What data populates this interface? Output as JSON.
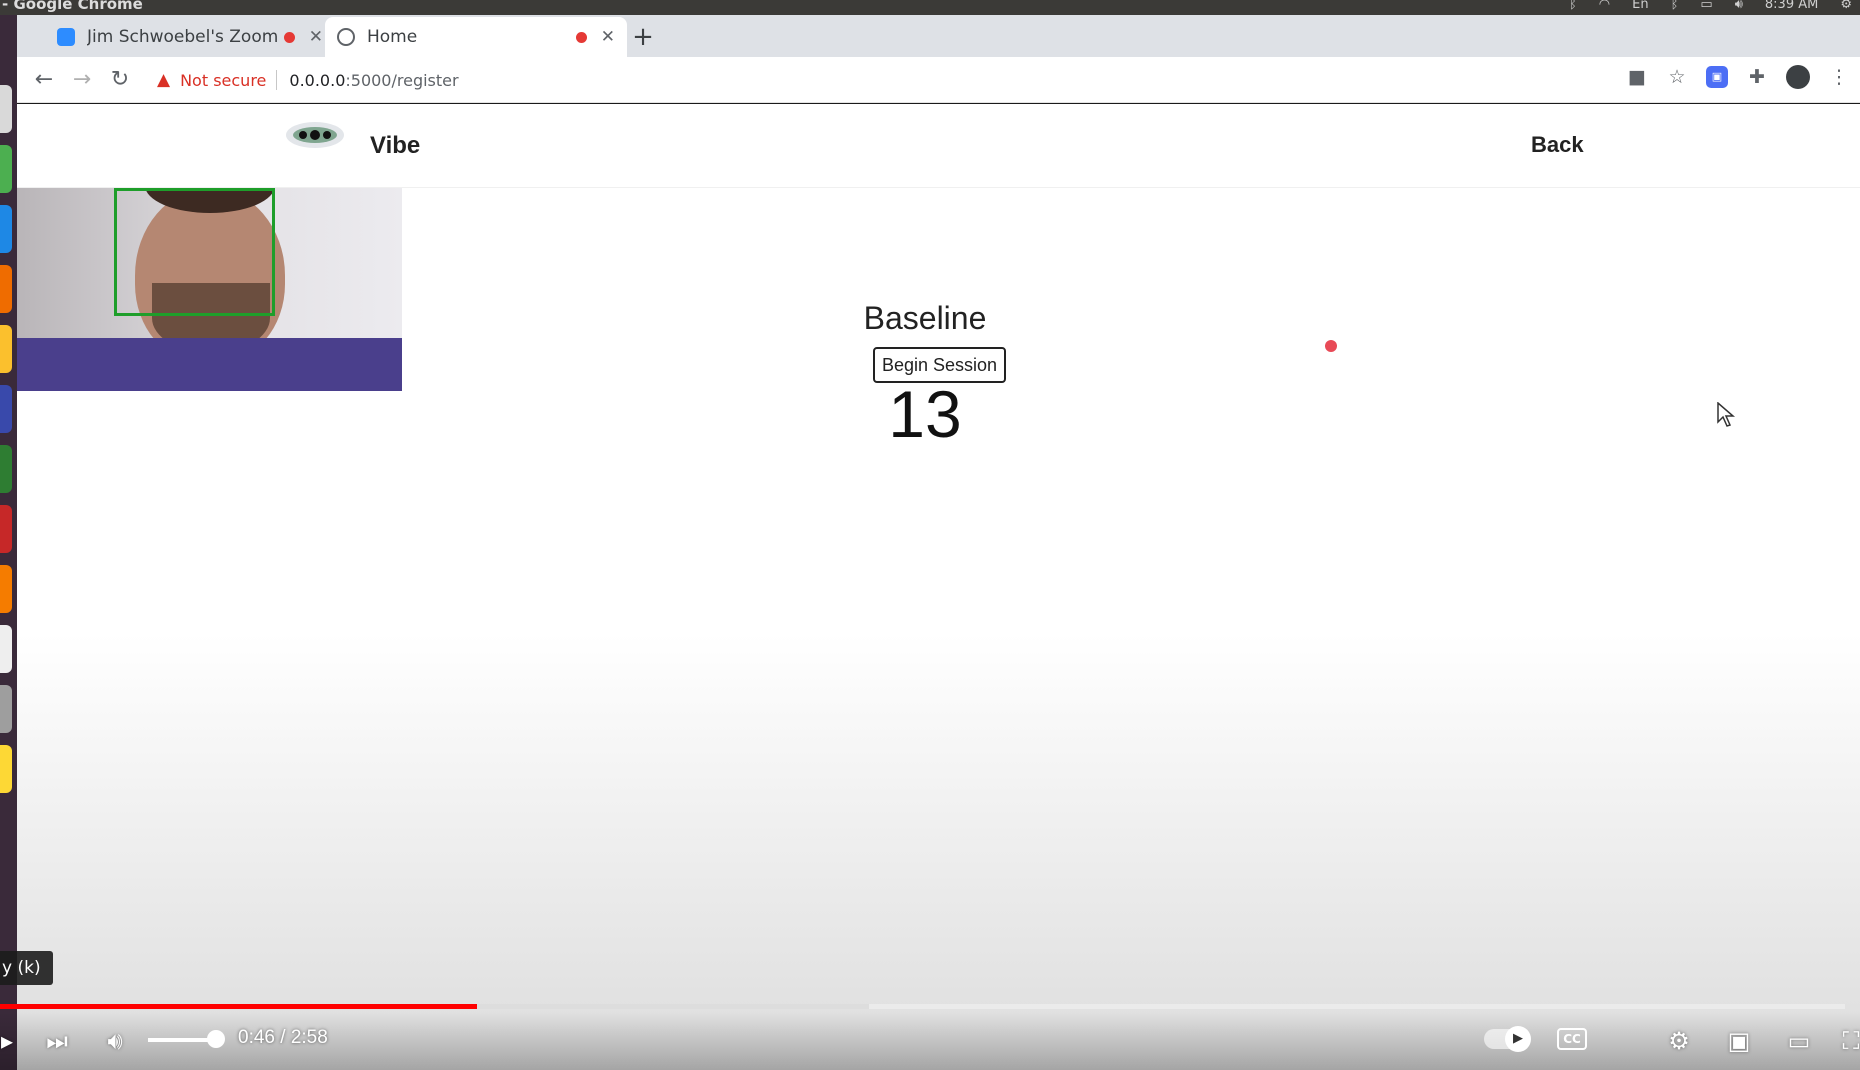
{
  "os": {
    "app_title": "- Google Chrome",
    "clock": "8:39 AM",
    "tray_lang": "En"
  },
  "tabs": [
    {
      "title": "Jim Schwoebel's Zoom",
      "recording": true
    },
    {
      "title": "Home",
      "recording": true
    }
  ],
  "toolbar": {
    "security_label": "Not secure",
    "url_host": "0.0.0.0",
    "url_path": ":5000/register"
  },
  "site": {
    "brand": "Vibe",
    "back_label": "Back"
  },
  "main": {
    "title": "Baseline",
    "begin_button": "Begin Session",
    "countdown": "13"
  },
  "player": {
    "tooltip": "y (k)",
    "time": "0:46 / 2:58",
    "played_fraction": 0.2584,
    "buffered_fraction": 0.4708,
    "cc_label": "CC"
  },
  "colors": {
    "accent_red": "#ff0000",
    "not_secure_red": "#d93025",
    "face_box_green": "#1e9e2a",
    "gaze_dot": "#e84a57"
  }
}
